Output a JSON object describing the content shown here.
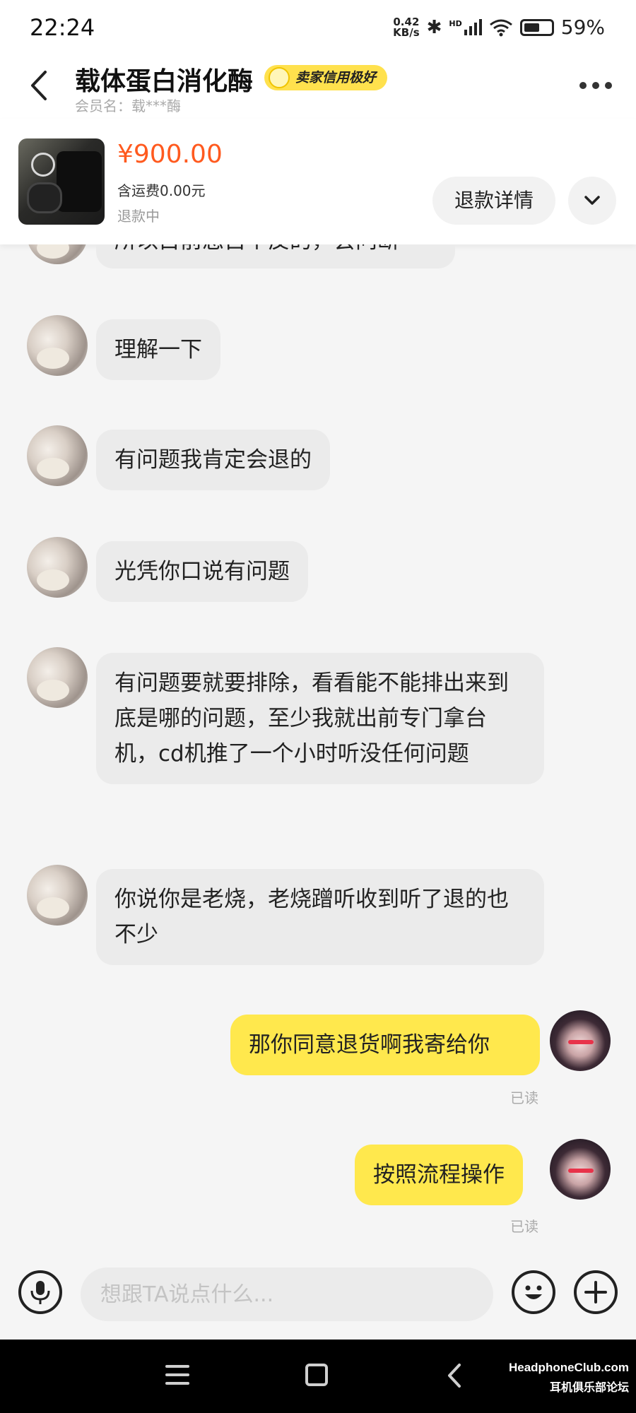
{
  "status_bar": {
    "time": "22:24",
    "net_speed_value": "0.42",
    "net_speed_unit": "KB/s",
    "signal_label": "HD",
    "battery_level": 0.59,
    "battery_percent": "59%"
  },
  "header": {
    "title": "载体蛋白消化酶",
    "badge": "卖家信用极好",
    "member_name": "会员名：载***酶"
  },
  "product": {
    "price": "¥900.00",
    "shipping": "含运费0.00元",
    "status": "退款中",
    "refund_detail_label": "退款详情"
  },
  "messages": [
    {
      "from": "seller",
      "text": "所以目前您自个反的，会问断"
    },
    {
      "from": "seller",
      "text": "理解一下"
    },
    {
      "from": "seller",
      "text": "有问题我肯定会退的"
    },
    {
      "from": "seller",
      "text": "光凭你口说有问题"
    },
    {
      "from": "seller",
      "text": "有问题要就要排除，看看能不能排出来到底是哪的问题，至少我就出前专门拿台机，cd机推了一个小时听没任何问题"
    },
    {
      "from": "seller",
      "text": "你说你是老烧，老烧蹭听收到听了退的也不少"
    },
    {
      "from": "buyer",
      "text": "那你同意退货啊我寄给你",
      "read": "已读"
    },
    {
      "from": "buyer",
      "text": "按照流程操作",
      "read": "已读"
    }
  ],
  "input": {
    "placeholder": "想跟TA说点什么..."
  },
  "watermark": {
    "site": "HeadphoneClub.com",
    "forum": "耳机俱乐部论坛"
  },
  "colors": {
    "accent_yellow": "#ffe84d",
    "price_orange": "#ff5a1f",
    "badge_yellow": "#ffe14d"
  }
}
